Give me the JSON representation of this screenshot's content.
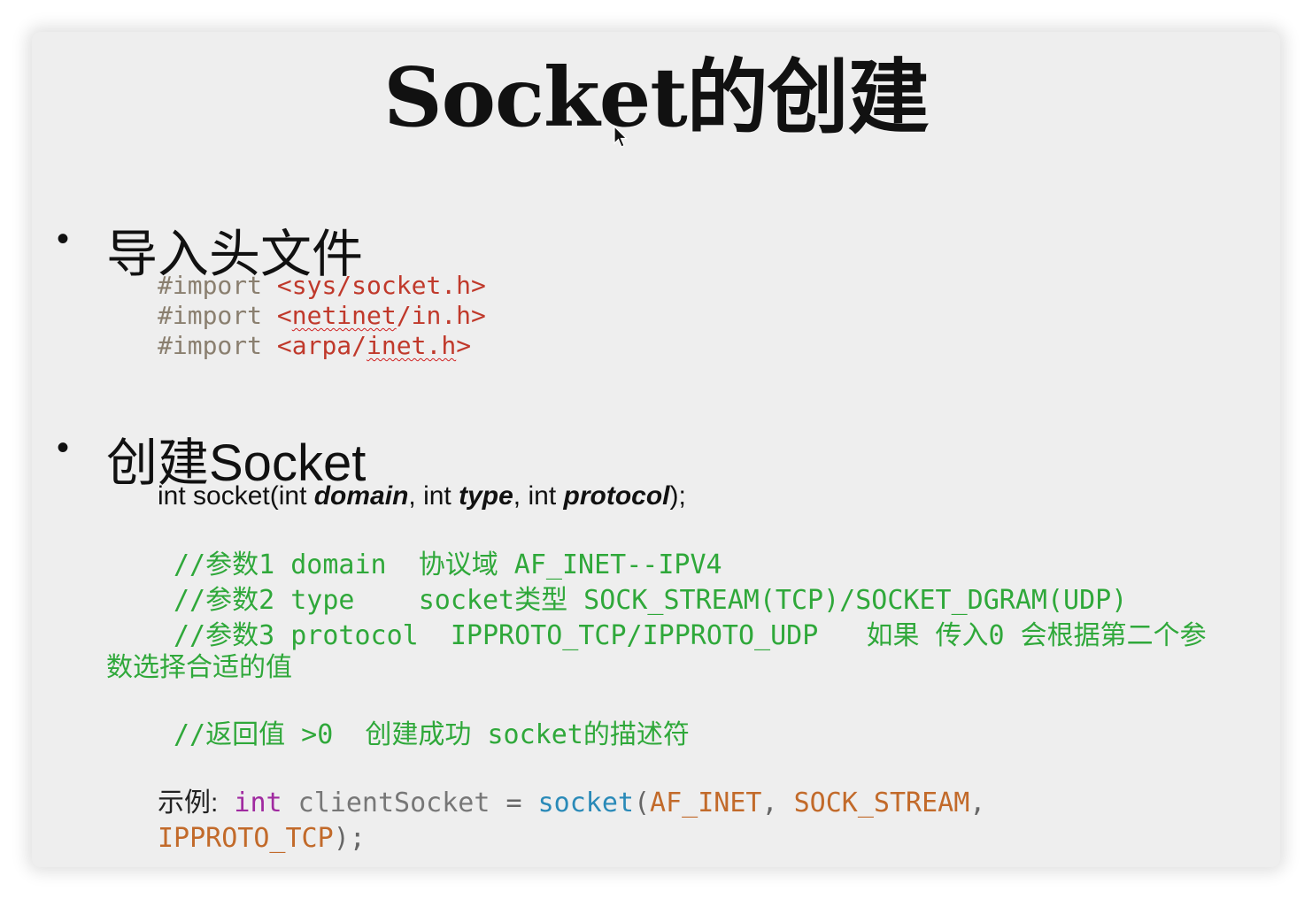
{
  "title": "Socket的创建",
  "sections": {
    "import": {
      "bullet": "•",
      "heading": "导入头文件",
      "lines": [
        {
          "directive": "#import",
          "path": "<sys/socket.h>"
        },
        {
          "directive": "#import",
          "path_prefix": "<",
          "path_err": "netinet",
          "path_suffix": "/in.h>"
        },
        {
          "directive": "#import",
          "path_prefix": "<arpa/",
          "path_err": "inet.h",
          "path_suffix": ">"
        }
      ]
    },
    "create": {
      "bullet": "•",
      "heading": "创建Socket",
      "signature": {
        "prefix": "int socket(int ",
        "p1": "domain",
        "mid1": ", int ",
        "p2": "type",
        "mid2": ", int ",
        "p3": "protocol",
        "suffix": ");"
      },
      "comments": {
        "line1": "//参数1 domain  协议域 AF_INET--IPV4",
        "line2": "//参数2 type    socket类型 SOCK_STREAM(TCP)/SOCKET_DGRAM(UDP)",
        "line3": "//参数3 protocol  IPPROTO_TCP/IPPROTO_UDP   如果 传入0 会根据第二个参",
        "line3_wrap": "数选择合适的值",
        "line4": "//返回值 >0  创建成功 socket的描述符"
      },
      "example": {
        "label": "示例:",
        "kw": "int",
        "var": "clientSocket",
        "eq": "=",
        "fn": "socket",
        "open": "(",
        "arg1": "AF_INET",
        "comma1": ",",
        "arg2": "SOCK_STREAM",
        "comma2": ",",
        "arg3": "IPPROTO_TCP",
        "close": ");"
      }
    }
  },
  "colors": {
    "comment": "#2fa83a",
    "directive": "#8a7f6f",
    "path": "#c0392b",
    "keyword": "#a02aa0",
    "function": "#2a8ab8",
    "constant": "#c26a2a"
  }
}
